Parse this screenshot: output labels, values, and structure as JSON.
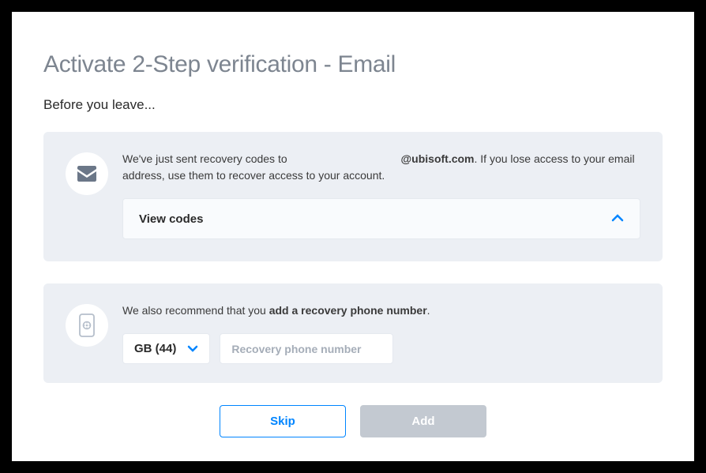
{
  "title": "Activate 2-Step verification - Email",
  "subtitle": "Before you leave...",
  "recovery": {
    "text_part1": "We've just sent recovery codes to ",
    "email_domain": "@ubisoft.com",
    "text_part2": ". If you lose access to your email address, use them to recover access to your account.",
    "accordion_label": "View codes"
  },
  "phone": {
    "text_part1": "We also recommend that you ",
    "text_bold": "add a recovery phone number",
    "text_part2": ".",
    "country_label": "GB (44)",
    "placeholder": "Recovery phone number"
  },
  "buttons": {
    "skip": "Skip",
    "add": "Add"
  }
}
